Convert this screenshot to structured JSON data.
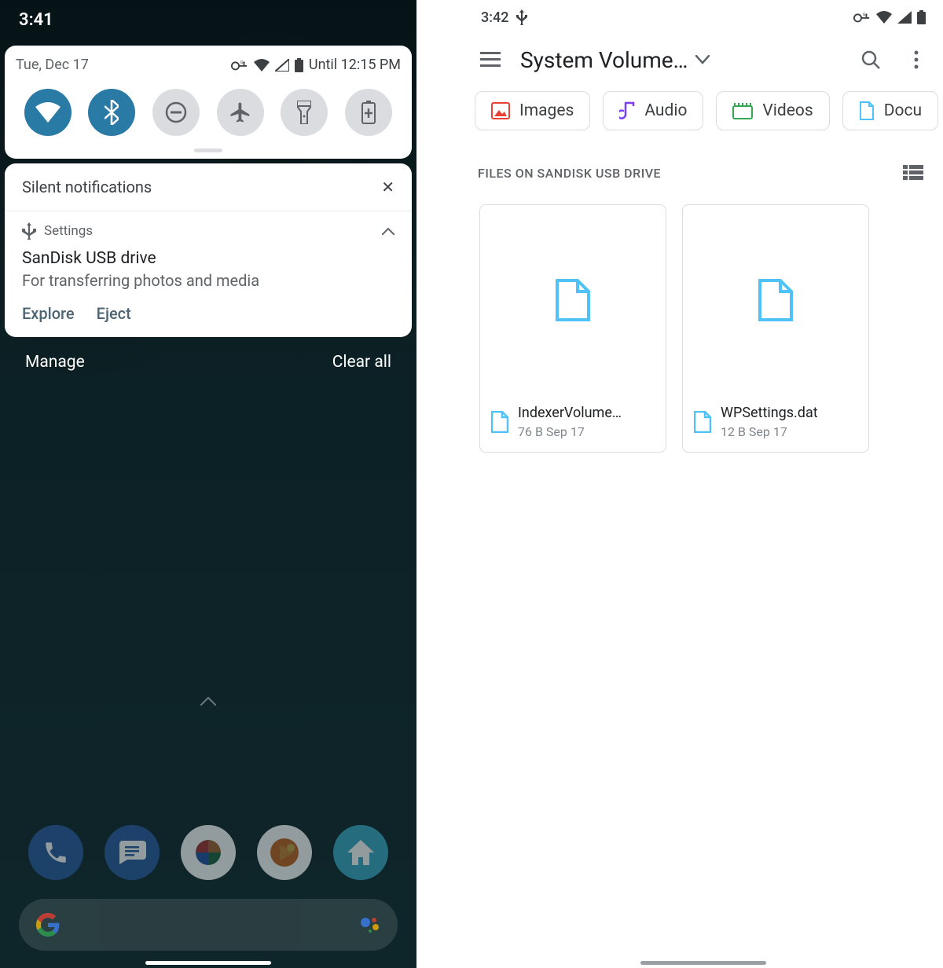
{
  "left": {
    "time": "3:41",
    "date": "Tue, Dec 17",
    "alarm_until": "Until 12:15 PM",
    "quick_toggles": [
      "wifi",
      "bluetooth",
      "dnd",
      "airplane",
      "flashlight",
      "battery"
    ],
    "silent_header": "Silent notifications",
    "notification": {
      "app": "Settings",
      "title": "SanDisk USB drive",
      "subtitle": "For transferring photos and media",
      "actions": {
        "explore": "Explore",
        "eject": "Eject"
      }
    },
    "manage": "Manage",
    "clear_all": "Clear all"
  },
  "right": {
    "time": "3:42",
    "title": "System Volume…",
    "chips": {
      "images": "Images",
      "audio": "Audio",
      "videos": "Videos",
      "documents": "Docu"
    },
    "section": "FILES ON SANDISK USB DRIVE",
    "files": [
      {
        "name": "IndexerVolume…",
        "meta": "76 B  Sep 17"
      },
      {
        "name": "WPSettings.dat",
        "meta": "12 B  Sep 17"
      }
    ]
  }
}
